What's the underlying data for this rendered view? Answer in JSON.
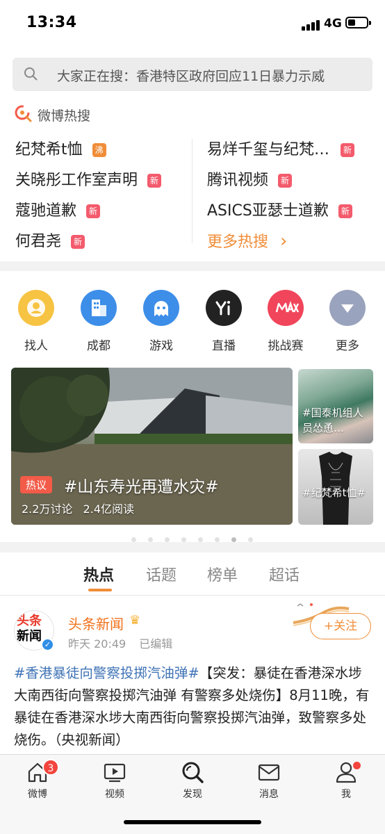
{
  "status_bar": {
    "time": "13:34",
    "network": "4G"
  },
  "search": {
    "placeholder": "大家正在搜：香港特区政府回应11日暴力示威"
  },
  "hot_search": {
    "title": "微博热搜",
    "left_items": [
      {
        "label": "纪梵希t恤",
        "badge": "沸",
        "badge_type": "boil"
      },
      {
        "label": "关晓彤工作室声明",
        "badge": "新",
        "badge_type": "new"
      },
      {
        "label": "蔻驰道歉",
        "badge": "新",
        "badge_type": "new"
      },
      {
        "label": "何君尧",
        "badge": "新",
        "badge_type": "new"
      }
    ],
    "right_items": [
      {
        "label": "易烊千玺与纪梵…",
        "badge": "新",
        "badge_type": "new"
      },
      {
        "label": "腾讯视频",
        "badge": "新",
        "badge_type": "new"
      },
      {
        "label": "ASICS亚瑟士道歉",
        "badge": "新",
        "badge_type": "new"
      }
    ],
    "more_label": "更多热搜",
    "more_arrow": "›"
  },
  "quick_links": [
    {
      "label": "找人",
      "icon": "find-person-icon",
      "color": "#f6c342"
    },
    {
      "label": "成都",
      "icon": "city-building-icon",
      "color": "#3d8ee8"
    },
    {
      "label": "游戏",
      "icon": "game-ghost-icon",
      "color": "#3d8ee8"
    },
    {
      "label": "直播",
      "icon": "yizhibo-live-icon",
      "color": "#222222"
    },
    {
      "label": "挑战赛",
      "icon": "max-challenge-icon",
      "color": "#f1455b"
    },
    {
      "label": "更多",
      "icon": "more-dropdown-icon",
      "color": "#9aa3bd"
    }
  ],
  "banner": {
    "tag": "热议",
    "title": "#山东寿光再遭水灾#",
    "discussions": "2.2万讨论",
    "reads": "2.4亿阅读",
    "side_items": [
      {
        "text": "#国泰机组人员怂恿…"
      },
      {
        "text": "#纪梵希t恤#"
      }
    ],
    "page_count": 8,
    "active_page": 7
  },
  "tabs": [
    {
      "label": "热点",
      "active": true
    },
    {
      "label": "话题",
      "active": false
    },
    {
      "label": "榜单",
      "active": false
    },
    {
      "label": "超话",
      "active": false
    }
  ],
  "post": {
    "avatar_text_top": "头条",
    "avatar_text_bottom": "新闻",
    "author": "头条新闻",
    "time": "昨天 20:49",
    "edited": "已编辑",
    "follow_label": "+关注",
    "topic": "#香港暴徒向警察投掷汽油弹#",
    "body": "【突发：暴徒在香港深水埗大南西街向警察投掷汽油弹 有警察多处烧伤】8月11晚，有暴徒在香港深水埗大南西街向警察投掷汽油弹，致警察多处烧伤。（央视新闻）"
  },
  "bottom_nav": [
    {
      "label": "微博",
      "icon": "home-icon",
      "badge": "3"
    },
    {
      "label": "视频",
      "icon": "video-play-icon"
    },
    {
      "label": "发现",
      "icon": "discover-search-icon"
    },
    {
      "label": "消息",
      "icon": "message-envelope-icon"
    },
    {
      "label": "我",
      "icon": "profile-person-icon"
    }
  ]
}
